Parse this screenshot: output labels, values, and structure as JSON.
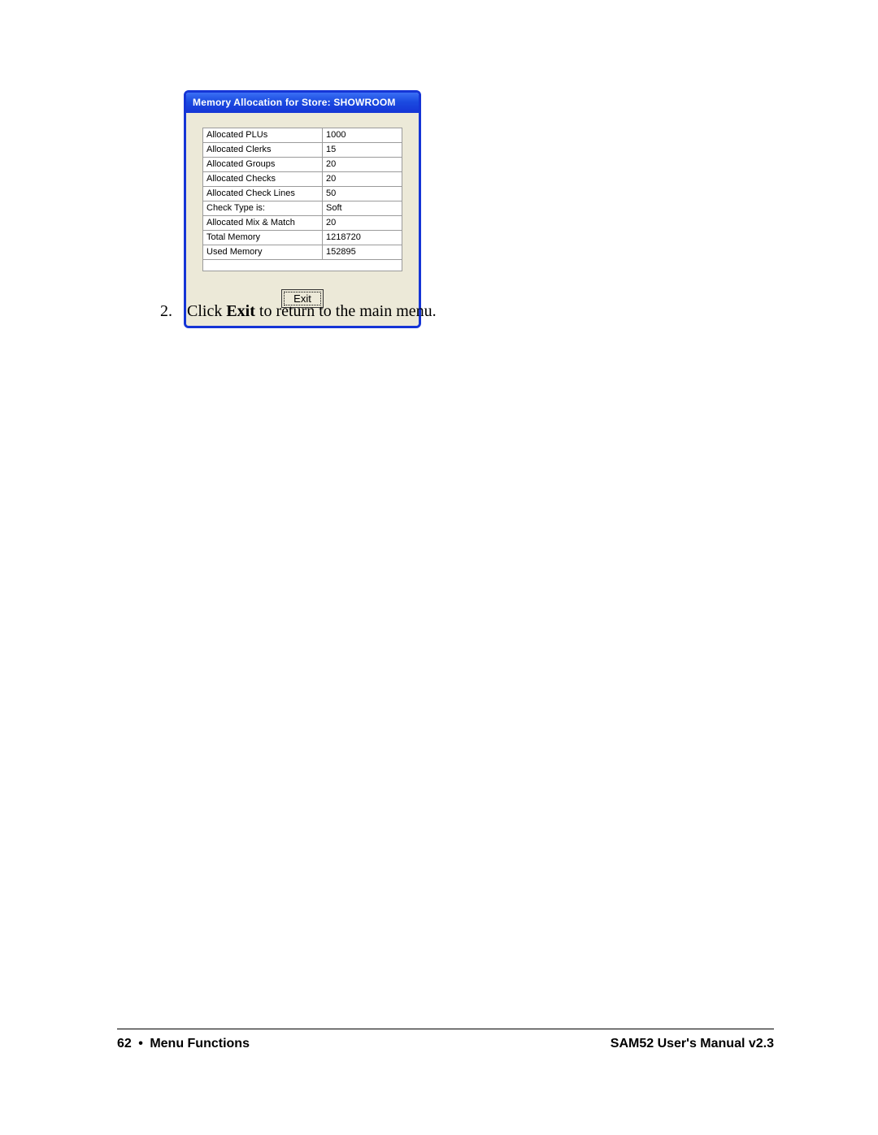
{
  "dialog": {
    "title": "Memory Allocation for Store:  SHOWROOM",
    "rows": [
      {
        "label": "Allocated PLUs",
        "value": "1000"
      },
      {
        "label": "Allocated Clerks",
        "value": "15"
      },
      {
        "label": "Allocated Groups",
        "value": "20"
      },
      {
        "label": "Allocated Checks",
        "value": "20"
      },
      {
        "label": "Allocated Check Lines",
        "value": "50"
      },
      {
        "label": "Check Type is:",
        "value": "Soft"
      },
      {
        "label": "Allocated Mix & Match",
        "value": "20"
      },
      {
        "label": "Total Memory",
        "value": "1218720"
      },
      {
        "label": "Used Memory",
        "value": "152895"
      }
    ],
    "exit_label": "Exit"
  },
  "step": {
    "number": "2.",
    "pre": "Click ",
    "bold": "Exit",
    "post": " to return to the main menu."
  },
  "footer": {
    "page_number": "62",
    "separator": "•",
    "section": "Menu Functions",
    "manual": "SAM52 User's Manual v2.3"
  }
}
